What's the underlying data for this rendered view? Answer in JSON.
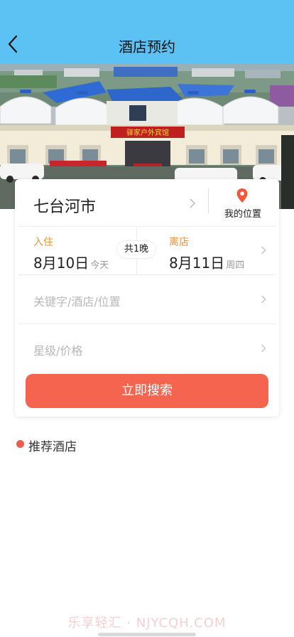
{
  "nav": {
    "title": "酒店预约",
    "back_icon": "back-arrow-icon",
    "color": "#5bc2f3"
  },
  "banner": {
    "alt": "hotel photo",
    "sign_text": "驿家户外宾馆"
  },
  "search_card": {
    "city": "七台河市",
    "my_location": "我的位置",
    "checkin": {
      "label": "入住",
      "date": "8月10日",
      "weekday": "今天"
    },
    "nights": "共1晚",
    "checkout": {
      "label": "离店",
      "date": "8月11日",
      "weekday": "周四"
    },
    "keyword_placeholder": "关键字/酒店/位置",
    "star_price_placeholder": "星级/价格",
    "search_button": "立即搜索",
    "accent": "#f4644e",
    "label_color": "#f0902e"
  },
  "recommended": {
    "title": "推荐酒店"
  },
  "watermark": "乐享轻汇 · NJYCQH.COM"
}
